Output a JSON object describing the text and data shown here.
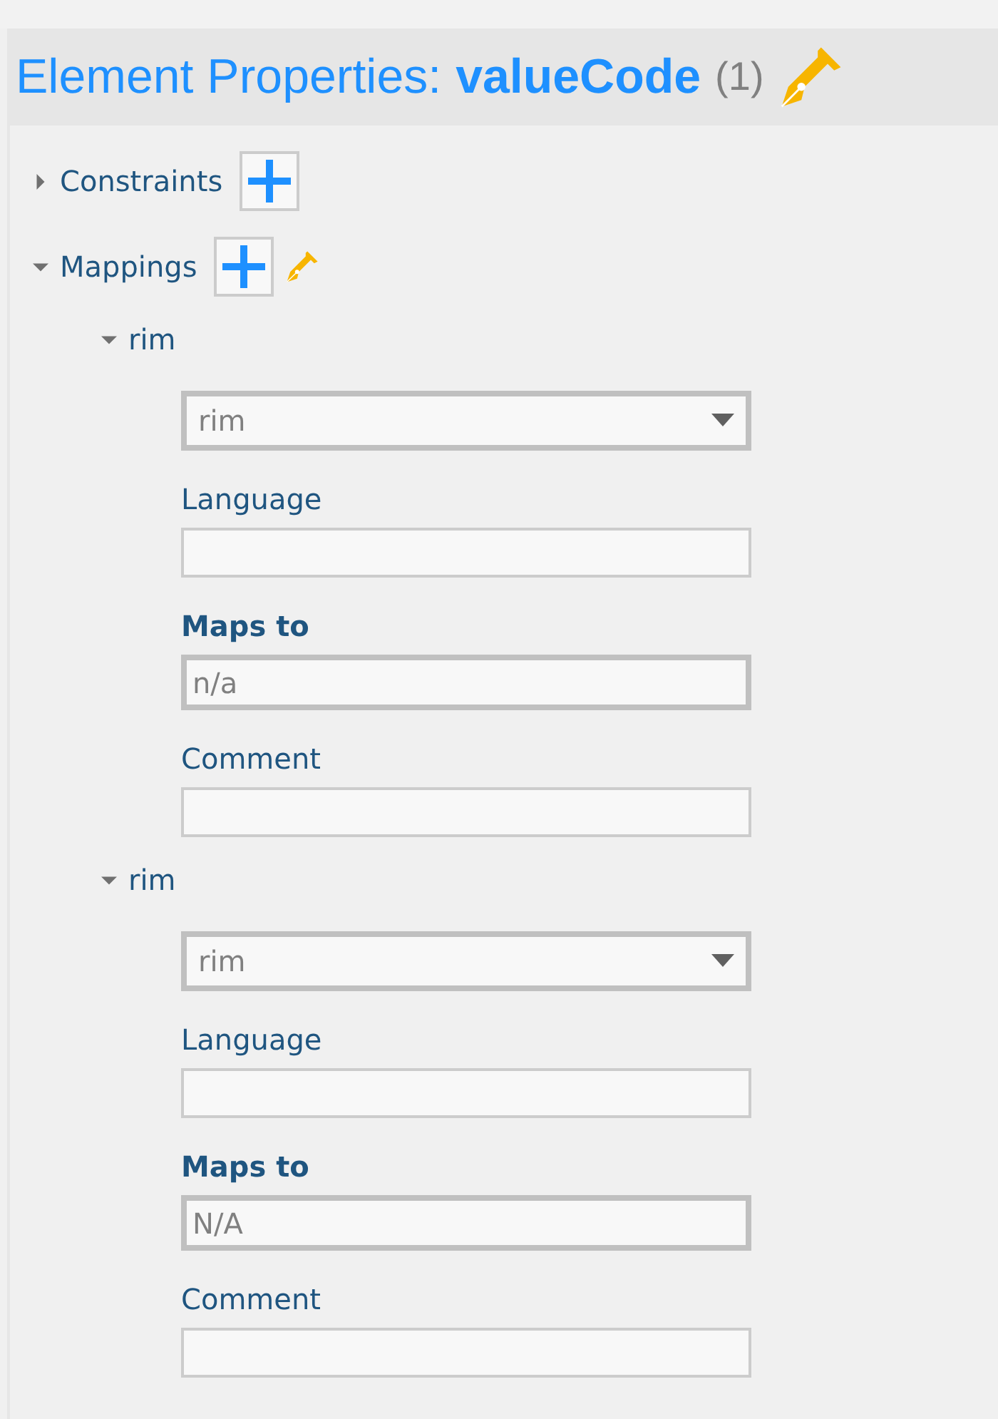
{
  "header": {
    "title": "Element Properties:",
    "element": "valueCode",
    "count": "(1)"
  },
  "sections": [
    {
      "label": "Constraints",
      "expanded": false,
      "editable": false
    },
    {
      "label": "Mappings",
      "expanded": true,
      "editable": true,
      "items": [
        {
          "label": "rim",
          "expanded": true,
          "fields": [
            {
              "kind": "select",
              "value": "rim"
            },
            {
              "kind": "text",
              "label": "Language",
              "required": false
            },
            {
              "kind": "text",
              "label": "Maps to",
              "required": true,
              "value": "n/a"
            },
            {
              "kind": "text",
              "label": "Comment",
              "required": false
            }
          ]
        },
        {
          "label": "rim",
          "expanded": true,
          "fields": [
            {
              "kind": "select",
              "value": "rim"
            },
            {
              "kind": "text",
              "label": "Language",
              "required": false
            },
            {
              "kind": "text",
              "label": "Maps to",
              "required": true,
              "value": "N/A"
            },
            {
              "kind": "text",
              "label": "Comment",
              "required": false
            }
          ]
        }
      ]
    }
  ]
}
